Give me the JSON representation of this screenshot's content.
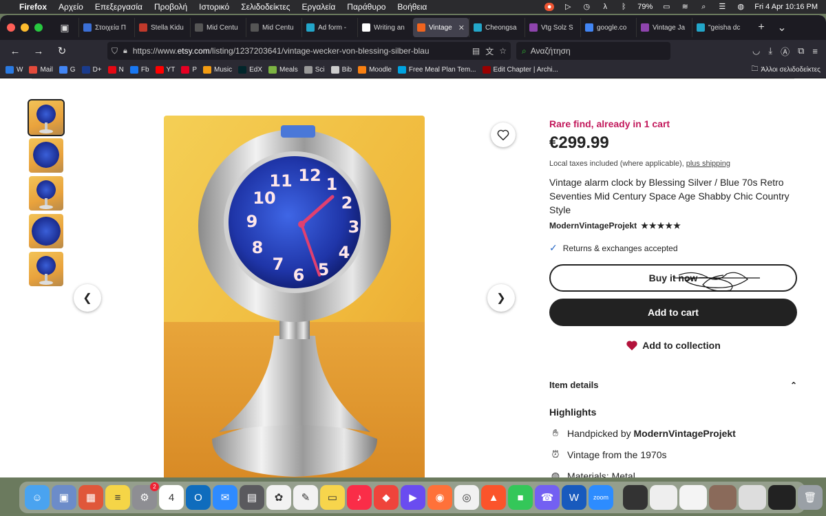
{
  "menubar": {
    "apple": "",
    "items": [
      "Firefox",
      "Αρχείο",
      "Επεξεργασία",
      "Προβολή",
      "Ιστορικό",
      "Σελιδοδείκτες",
      "Εργαλεία",
      "Παράθυρο",
      "Βοήθεια"
    ],
    "battery": "79%",
    "datetime": "Fri 4 Apr  10:16 PM"
  },
  "tabs": [
    {
      "title": "Στοιχεία Π",
      "color": "#3b6fd6"
    },
    {
      "title": "Stella Kidu",
      "color": "#c0392b"
    },
    {
      "title": "Mid Centu",
      "color": "#555555"
    },
    {
      "title": "Mid Centu",
      "color": "#555555"
    },
    {
      "title": "Ad form -",
      "color": "#23a6c9"
    },
    {
      "title": "Writing an",
      "color": "#ffffff"
    },
    {
      "title": "Vintage",
      "color": "#f1641e",
      "active": true
    },
    {
      "title": "Cheongsa",
      "color": "#23a6c9"
    },
    {
      "title": "Vtg Solz S",
      "color": "#8e44ad"
    },
    {
      "title": "google.co",
      "color": "#4285f4"
    },
    {
      "title": "Vintage Ja",
      "color": "#8e44ad"
    },
    {
      "title": "\"geisha dc",
      "color": "#23a6c9"
    }
  ],
  "address": {
    "url_prefix": "https://www.",
    "url_host": "etsy.com",
    "url_path": "/listing/1237203641/vintage-wecker-von-blessing-silber-blau",
    "search_placeholder": "Αναζήτηση"
  },
  "bookmarks": [
    {
      "label": "W",
      "color": "#2a7ae2"
    },
    {
      "label": "Mail",
      "color": "#e34a3b"
    },
    {
      "label": "G",
      "color": "#4285f4"
    },
    {
      "label": "D+",
      "color": "#1a3b8c"
    },
    {
      "label": "N",
      "color": "#e50914"
    },
    {
      "label": "Fb",
      "color": "#1877f2"
    },
    {
      "label": "YT",
      "color": "#ff0000"
    },
    {
      "label": "P",
      "color": "#e60023"
    },
    {
      "label": "Music",
      "color": "#f39c12"
    },
    {
      "label": "EdX",
      "color": "#02262b"
    },
    {
      "label": "Meals",
      "color": "#7cb342"
    },
    {
      "label": "Sci",
      "color": "#999999"
    },
    {
      "label": "Bib",
      "color": "#cccccc"
    },
    {
      "label": "Moodle",
      "color": "#f98012"
    },
    {
      "label": "Free Meal Plan Tem...",
      "color": "#00a3e0"
    },
    {
      "label": "Edit Chapter | Archi...",
      "color": "#990000"
    }
  ],
  "bookmarks_other": "Άλλοι σελιδοδείκτες",
  "listing": {
    "rare": "Rare find, already in 1 cart",
    "price": "€299.99",
    "taxes": "Local taxes included (where applicable),",
    "shipping_link": "plus shipping",
    "title": "Vintage alarm clock by Blessing Silver / Blue 70s Retro Seventies Mid Century Space Age Shabby Chic Country Style",
    "shop": "ModernVintageProjekt",
    "stars": "★★★★★",
    "rating": 5,
    "returns": "Returns & exchanges accepted",
    "buy_now": "Buy it now",
    "add_to_cart": "Add to cart",
    "add_to_collection": "Add to collection",
    "item_details": "Item details",
    "highlights_heading": "Highlights",
    "handpicked_prefix": "Handpicked by",
    "handpicked_shop": "ModernVintageProjekt",
    "vintage_from": "Vintage from the 1970s",
    "materials": "Materials: Metal"
  },
  "colors": {
    "accent_rare": "#c2185b",
    "button_dark": "#222222",
    "heart": "#b3123b"
  },
  "dock": {
    "apps": [
      {
        "name": "finder",
        "color": "#4aa3f0",
        "glyph": "☺"
      },
      {
        "name": "preview",
        "color": "#6c8cc9",
        "glyph": "▣"
      },
      {
        "name": "launchpad",
        "color": "#e0573a",
        "glyph": "▦"
      },
      {
        "name": "notes-stickies",
        "color": "#f5d547",
        "glyph": "≡"
      },
      {
        "name": "system-settings",
        "color": "#8e8e93",
        "glyph": "⚙",
        "badge": "2"
      },
      {
        "name": "calendar",
        "color": "#ffffff",
        "glyph": "4"
      },
      {
        "name": "outlook",
        "color": "#0f6cbd",
        "glyph": "O"
      },
      {
        "name": "messenger",
        "color": "#2e8bff",
        "glyph": "✉"
      },
      {
        "name": "calculator",
        "color": "#5a5a5e",
        "glyph": "▤"
      },
      {
        "name": "photos",
        "color": "#f2f2f2",
        "glyph": "✿"
      },
      {
        "name": "freeform",
        "color": "#f2f2f2",
        "glyph": "✎"
      },
      {
        "name": "notes",
        "color": "#f7d54c",
        "glyph": "▭"
      },
      {
        "name": "music",
        "color": "#fa2d48",
        "glyph": "♪"
      },
      {
        "name": "anydesk",
        "color": "#ef443b",
        "glyph": "◆"
      },
      {
        "name": "infuse",
        "color": "#6a4cf0",
        "glyph": "▶"
      },
      {
        "name": "firefox",
        "color": "#ff7139",
        "glyph": "◉"
      },
      {
        "name": "chrome",
        "color": "#f1f1f1",
        "glyph": "◎"
      },
      {
        "name": "brave",
        "color": "#fb542b",
        "glyph": "▲"
      },
      {
        "name": "facetime",
        "color": "#34c759",
        "glyph": "■"
      },
      {
        "name": "viber",
        "color": "#7360f2",
        "glyph": "☎"
      },
      {
        "name": "word",
        "color": "#185abd",
        "glyph": "W"
      },
      {
        "name": "zoom",
        "color": "#2d8cff",
        "glyph": "zoom"
      }
    ]
  }
}
